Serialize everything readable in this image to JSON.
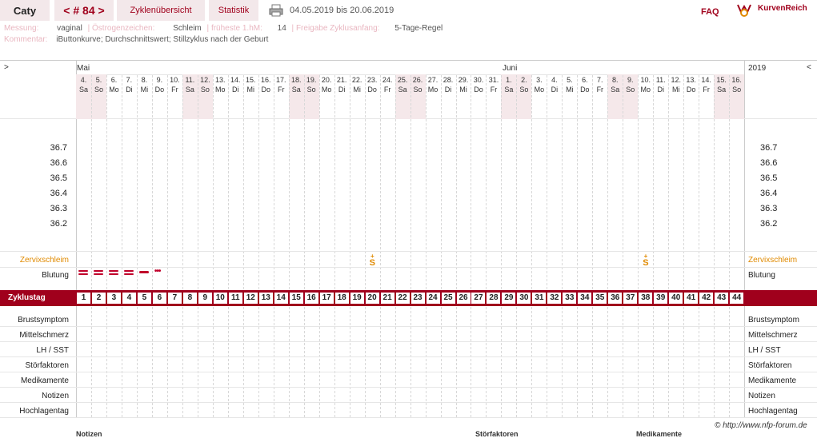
{
  "header": {
    "user": "Caty",
    "nav": "< # 84 >",
    "tab_overview": "Zyklenübersicht",
    "tab_stats": "Statistik",
    "date_range": "04.05.2019 bis 20.06.2019",
    "faq": "FAQ",
    "brand": "KurvenReich"
  },
  "meta": {
    "messung_label": "Messung:",
    "messung_value": "vaginal",
    "oestrogen_label": "Östrogenzeichen:",
    "oestrogen_value": "Schleim",
    "fruehste_label": "früheste 1.hM:",
    "fruehste_value": "14",
    "freigabe_label": "Freigabe Zyklusanfang:",
    "freigabe_value": "5-Tage-Regel",
    "kommentar_label": "Kommentar:",
    "kommentar_value": "iButtonkurve; Durchschnittswert; Stillzyklus nach der Geburt"
  },
  "calendar": {
    "left_arrow": ">",
    "right_arrow": "<",
    "year": "2019",
    "month_may": "Mai",
    "month_june": "Juni",
    "days": [
      {
        "n": "4.",
        "d": "Sa"
      },
      {
        "n": "5.",
        "d": "So"
      },
      {
        "n": "6.",
        "d": "Mo"
      },
      {
        "n": "7.",
        "d": "Di"
      },
      {
        "n": "8.",
        "d": "Mi"
      },
      {
        "n": "9.",
        "d": "Do"
      },
      {
        "n": "10.",
        "d": "Fr"
      },
      {
        "n": "11.",
        "d": "Sa"
      },
      {
        "n": "12.",
        "d": "So"
      },
      {
        "n": "13.",
        "d": "Mo"
      },
      {
        "n": "14.",
        "d": "Di"
      },
      {
        "n": "15.",
        "d": "Mi"
      },
      {
        "n": "16.",
        "d": "Do"
      },
      {
        "n": "17.",
        "d": "Fr"
      },
      {
        "n": "18.",
        "d": "Sa"
      },
      {
        "n": "19.",
        "d": "So"
      },
      {
        "n": "20.",
        "d": "Mo"
      },
      {
        "n": "21.",
        "d": "Di"
      },
      {
        "n": "22.",
        "d": "Mi"
      },
      {
        "n": "23.",
        "d": "Do"
      },
      {
        "n": "24.",
        "d": "Fr"
      },
      {
        "n": "25.",
        "d": "Sa"
      },
      {
        "n": "26.",
        "d": "So"
      },
      {
        "n": "27.",
        "d": "Mo"
      },
      {
        "n": "28.",
        "d": "Di"
      },
      {
        "n": "29.",
        "d": "Mi"
      },
      {
        "n": "30.",
        "d": "Do"
      },
      {
        "n": "31.",
        "d": "Fr"
      },
      {
        "n": "1.",
        "d": "Sa"
      },
      {
        "n": "2.",
        "d": "So"
      },
      {
        "n": "3.",
        "d": "Mo"
      },
      {
        "n": "4.",
        "d": "Di"
      },
      {
        "n": "5.",
        "d": "Mi"
      },
      {
        "n": "6.",
        "d": "Do"
      },
      {
        "n": "7.",
        "d": "Fr"
      },
      {
        "n": "8.",
        "d": "Sa"
      },
      {
        "n": "9.",
        "d": "So"
      },
      {
        "n": "10.",
        "d": "Mo"
      },
      {
        "n": "11.",
        "d": "Di"
      },
      {
        "n": "12.",
        "d": "Mi"
      },
      {
        "n": "13.",
        "d": "Do"
      },
      {
        "n": "14.",
        "d": "Fr"
      },
      {
        "n": "15.",
        "d": "Sa"
      },
      {
        "n": "16.",
        "d": "So"
      }
    ]
  },
  "temp_axis": [
    "36.7",
    "36.6",
    "36.5",
    "36.4",
    "36.3",
    "36.2"
  ],
  "rows": {
    "zervix": "Zervixschleim",
    "zervix_mark": "S",
    "zervix_days": [
      20,
      38
    ],
    "blutung": "Blutung",
    "blutung_heavy_days": [
      1,
      2,
      3,
      4
    ],
    "blutung_medium_days": [
      5
    ],
    "blutung_spot_days": [
      6
    ],
    "zyklustag": "Zyklustag",
    "zyklustage": [
      "1",
      "2",
      "3",
      "4",
      "5",
      "6",
      "7",
      "8",
      "9",
      "10",
      "11",
      "12",
      "13",
      "14",
      "15",
      "16",
      "17",
      "18",
      "19",
      "20",
      "21",
      "22",
      "23",
      "24",
      "25",
      "26",
      "27",
      "28",
      "29",
      "30",
      "31",
      "32",
      "33",
      "34",
      "35",
      "36",
      "37",
      "38",
      "39",
      "40",
      "41",
      "42",
      "43",
      "44"
    ],
    "lower": [
      "Brustsymptom",
      "Mittelschmerz",
      "LH / SST",
      "Störfaktoren",
      "Medikamente",
      "Notizen",
      "Hochlagentag"
    ]
  },
  "footer": {
    "copyright": "© http://www.nfp-forum.de",
    "notizen": "Notizen",
    "stoerfaktoren": "Störfaktoren",
    "medikamente": "Medikamente"
  },
  "colors": {
    "accent": "#a0001c",
    "weekend": "#f5e8ea",
    "zervix": "#e08a00"
  }
}
